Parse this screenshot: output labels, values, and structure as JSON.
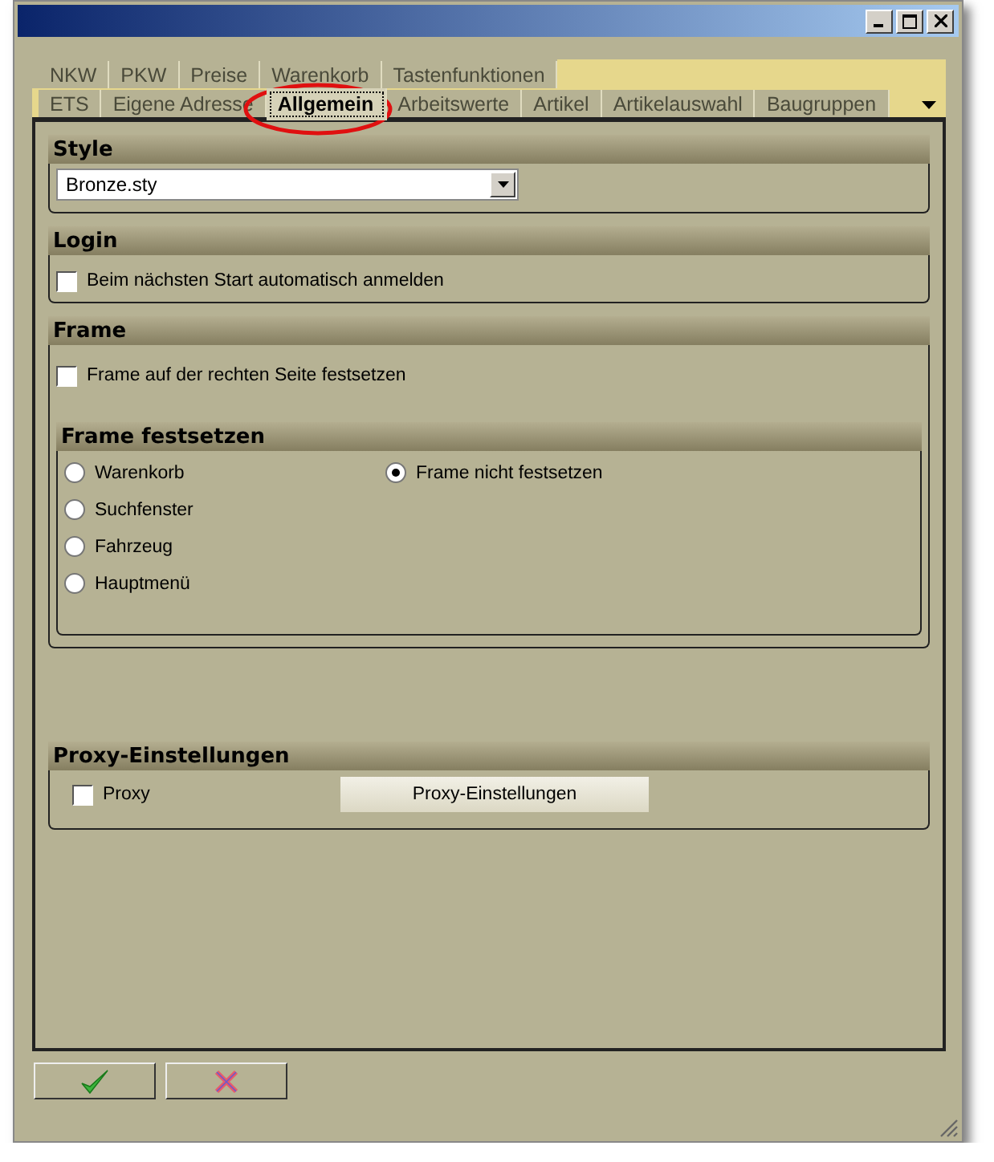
{
  "tab_rows": [
    {
      "tabs": [
        {
          "label": "NKW",
          "selected": false
        },
        {
          "label": "PKW",
          "selected": false
        },
        {
          "label": "Preise",
          "selected": false
        },
        {
          "label": "Warenkorb",
          "selected": false
        },
        {
          "label": "Tastenfunktionen",
          "selected": false
        }
      ]
    },
    {
      "tabs": [
        {
          "label": "ETS",
          "selected": false
        },
        {
          "label": "Eigene Adresse",
          "selected": false
        },
        {
          "label": "Allgemein",
          "selected": true
        },
        {
          "label": "Arbeitswerte",
          "selected": false
        },
        {
          "label": "Artikel",
          "selected": false
        },
        {
          "label": "Artikelauswahl",
          "selected": false
        },
        {
          "label": "Baugruppen",
          "selected": false
        }
      ]
    }
  ],
  "style": {
    "title": "Style",
    "dropdown": {
      "value": "Bronze.sty"
    }
  },
  "login": {
    "title": "Login",
    "checkbox": {
      "label": "Beim nächsten Start automatisch anmelden",
      "checked": false
    }
  },
  "frame": {
    "title": "Frame",
    "checkbox": {
      "label": "Frame auf der rechten Seite festsetzen",
      "checked": false
    },
    "group": {
      "title": "Frame festsetzen",
      "options": [
        {
          "label": "Warenkorb",
          "selected": false
        },
        {
          "label": "Suchfenster",
          "selected": false
        },
        {
          "label": "Fahrzeug",
          "selected": false
        },
        {
          "label": "Hauptmenü",
          "selected": false
        },
        {
          "label": "Frame nicht festsetzen",
          "selected": true
        }
      ]
    }
  },
  "proxy": {
    "title": "Proxy-Einstellungen",
    "checkbox": {
      "label": "Proxy",
      "checked": false
    },
    "button": "Proxy-Einstellungen"
  },
  "footer_buttons": [
    {
      "kind": "confirm"
    },
    {
      "kind": "cancel"
    }
  ]
}
